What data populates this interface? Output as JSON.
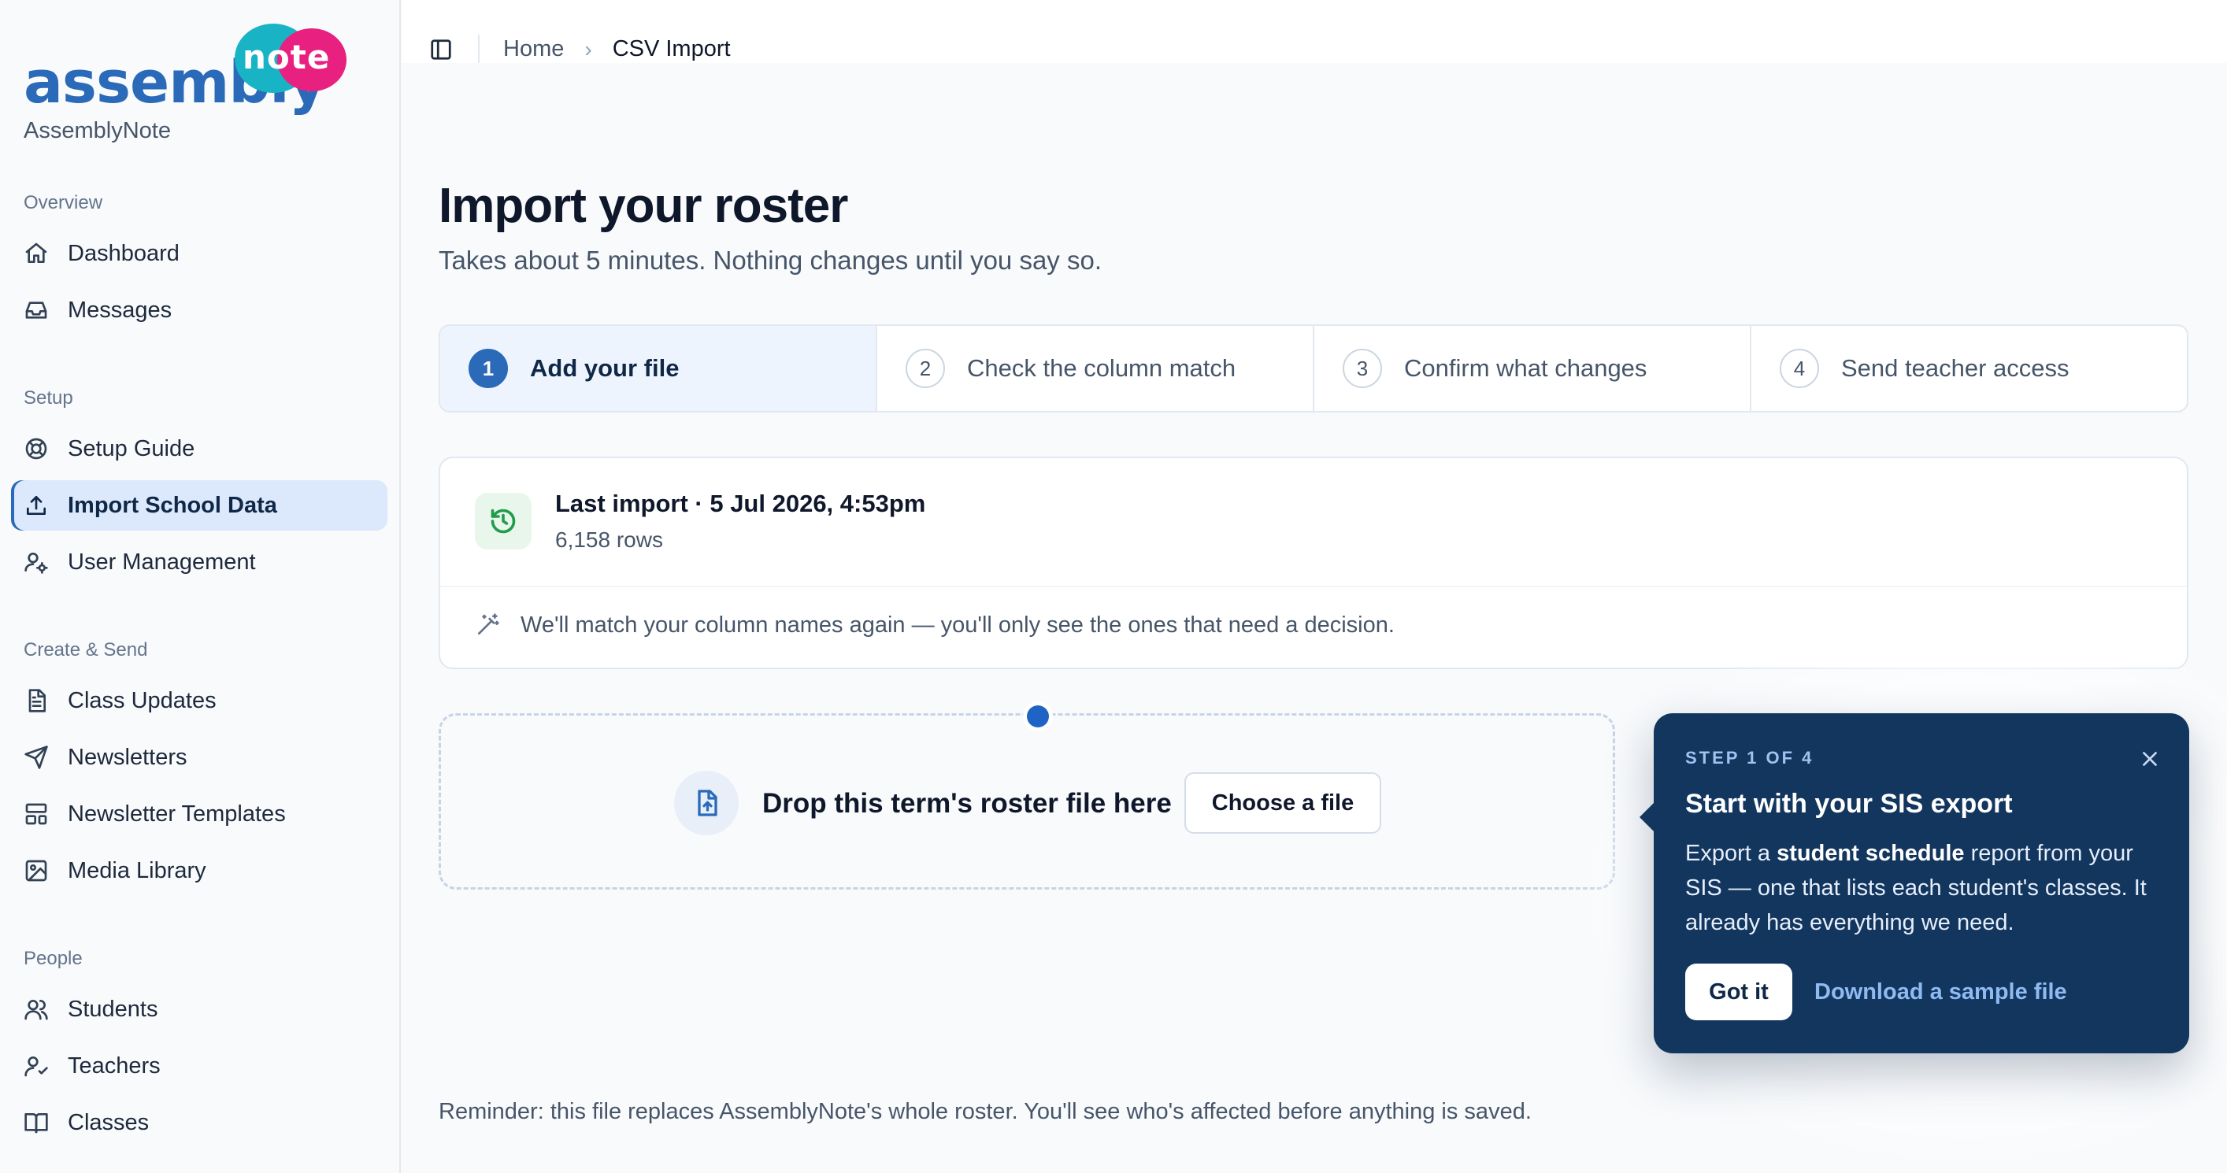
{
  "brand": {
    "logo_word": "assembly",
    "logo_accent": "note",
    "name": "AssemblyNote",
    "colors": {
      "primary": "#2a6ab8",
      "teal": "#19b3c6",
      "pink": "#e8207f"
    }
  },
  "sidebar": {
    "sections": [
      {
        "label": "Overview",
        "items": [
          {
            "label": "Dashboard",
            "icon": "home-icon"
          },
          {
            "label": "Messages",
            "icon": "inbox-icon"
          }
        ]
      },
      {
        "label": "Setup",
        "items": [
          {
            "label": "Setup Guide",
            "icon": "lifebuoy-icon"
          },
          {
            "label": "Import School Data",
            "icon": "upload-icon",
            "active": true
          },
          {
            "label": "User Management",
            "icon": "user-cog-icon"
          }
        ]
      },
      {
        "label": "Create & Send",
        "items": [
          {
            "label": "Class Updates",
            "icon": "document-icon"
          },
          {
            "label": "Newsletters",
            "icon": "send-icon"
          },
          {
            "label": "Newsletter Templates",
            "icon": "template-icon"
          },
          {
            "label": "Media Library",
            "icon": "image-icon"
          }
        ]
      },
      {
        "label": "People",
        "items": [
          {
            "label": "Students",
            "icon": "users-icon"
          },
          {
            "label": "Teachers",
            "icon": "teacher-icon"
          },
          {
            "label": "Classes",
            "icon": "book-icon"
          }
        ]
      }
    ]
  },
  "topbar": {
    "breadcrumb": {
      "home": "Home",
      "separator": "›",
      "current": "CSV Import"
    }
  },
  "main": {
    "title": "Import your roster",
    "subtitle": "Takes about 5 minutes. Nothing changes until you say so.",
    "steps": [
      {
        "number": "1",
        "label": "Add your file",
        "active": true
      },
      {
        "number": "2",
        "label": "Check the column match"
      },
      {
        "number": "3",
        "label": "Confirm what changes"
      },
      {
        "number": "4",
        "label": "Send teacher access"
      }
    ],
    "last_import": {
      "title": "Last import · 5 Jul 2026, 4:53pm",
      "rows": "6,158 rows",
      "note": "We'll match your column names again — you'll only see the ones that need a decision."
    },
    "dropzone": {
      "text": "Drop this term's roster file here",
      "button": "Choose a file"
    },
    "reminder": "Reminder: this file replaces AssemblyNote's whole roster. You'll see who's affected before anything is saved."
  },
  "popover": {
    "step": "STEP 1 OF 4",
    "title": "Start with your SIS export",
    "body_pre": "Export a ",
    "body_bold": "student schedule",
    "body_post": " report from your SIS — one that lists each student's classes. It already has everything we need.",
    "primary": "Got it",
    "link": "Download a sample file",
    "background": "#13365f"
  }
}
